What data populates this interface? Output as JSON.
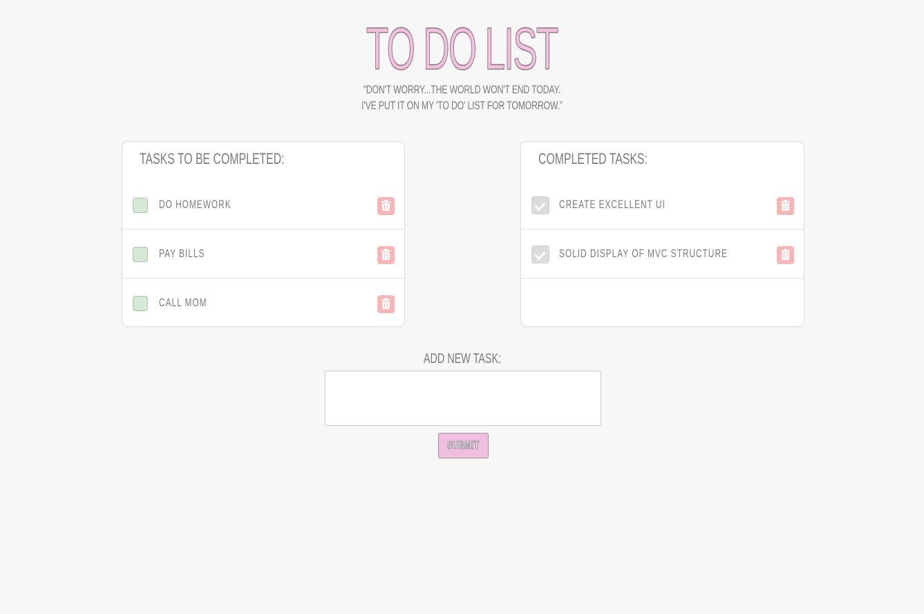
{
  "header": {
    "title": "TO DO LIST",
    "quote_line1": "“DON'T WORRY...THE WORLD WON'T END TODAY.",
    "quote_line2": "I'VE PUT IT ON MY 'TO DO' LIST FOR TOMORROW.”"
  },
  "pending": {
    "title": "TASKS TO BE COMPLETED:",
    "tasks": [
      {
        "label": "DO HOMEWORK",
        "checked": false
      },
      {
        "label": "PAY BILLS",
        "checked": false
      },
      {
        "label": "CALL MOM",
        "checked": false
      }
    ]
  },
  "completed": {
    "title": "COMPLETED TASKS:",
    "tasks": [
      {
        "label": "CREATE EXCELLENT UI",
        "checked": true
      },
      {
        "label": "SOLID DISPLAY OF MVC STRUCTURE",
        "checked": true
      }
    ]
  },
  "add_task": {
    "label": "ADD NEW TASK:",
    "value": "",
    "submit_label": "SUBMIT"
  },
  "icons": {
    "delete": "trash-icon",
    "check": "check-icon"
  },
  "colors": {
    "background": "#f7f7f7",
    "title_fill": "#f1c1df",
    "checkbox_pending": "#d5ead6",
    "checkbox_done": "#dcdcdc",
    "delete_button": "#f8b5b5",
    "submit_button": "#f0bfe0"
  }
}
